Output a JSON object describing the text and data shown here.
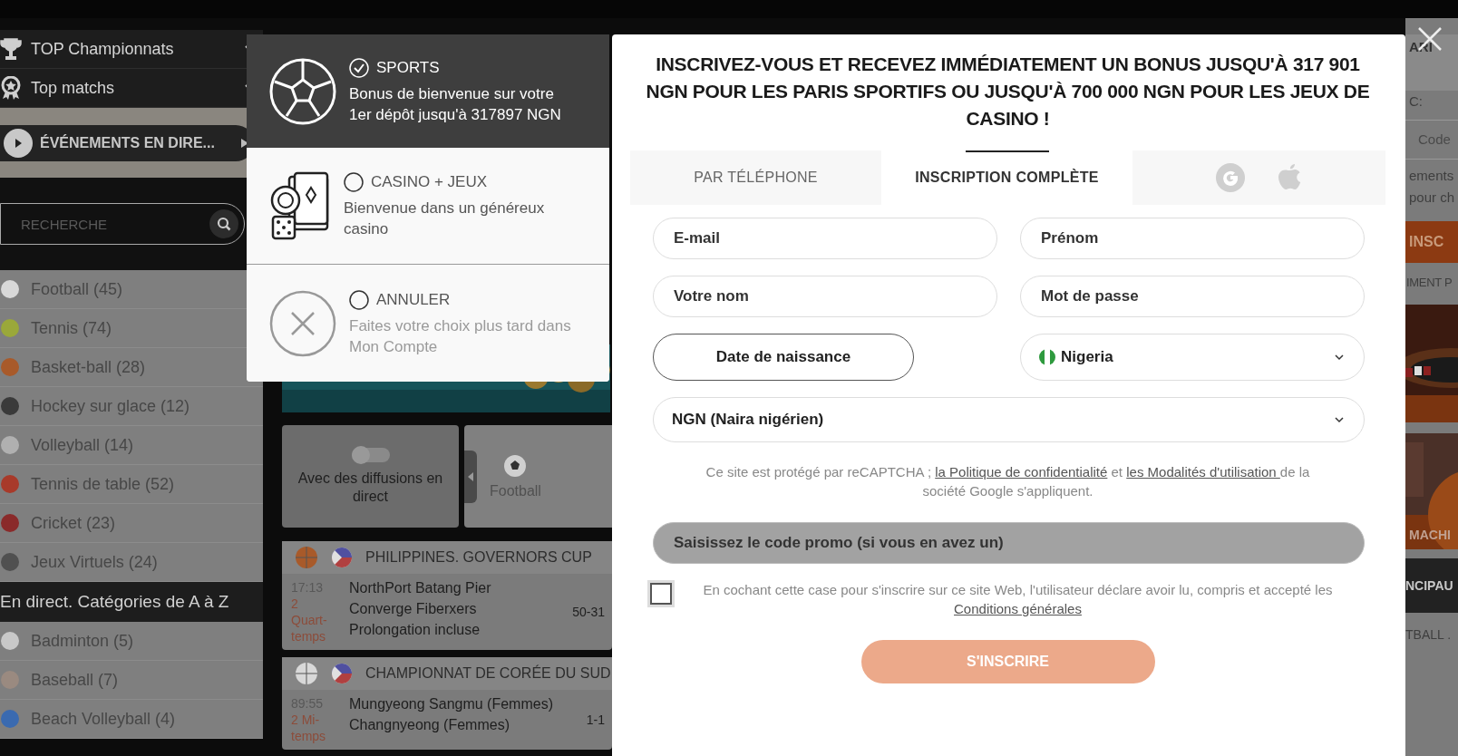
{
  "sidebar": {
    "menu": [
      {
        "label": "TOP Championnats",
        "expanded": false
      },
      {
        "label": "Top matchs",
        "expanded": false
      }
    ],
    "live_button": "ÉVÉNEMENTS EN DIRE...",
    "search": {
      "placeholder": "RECHERCHE"
    },
    "sports": [
      {
        "label": "Football (45)",
        "color": "#d8d8d8"
      },
      {
        "label": "Tennis (74)",
        "color": "#9aa83a"
      },
      {
        "label": "Basket-ball (28)",
        "color": "#a85a2a"
      },
      {
        "label": "Hockey sur glace (12)",
        "color": "#3a3a3a"
      },
      {
        "label": "Volleyball (14)",
        "color": "#b0b0b0"
      },
      {
        "label": "Tennis de table (52)",
        "color": "#a83a2a"
      },
      {
        "label": "Cricket (23)",
        "color": "#8a2a2a"
      },
      {
        "label": "Jeux Virtuels (24)",
        "color": "#505050"
      }
    ],
    "section_title": "En direct. Catégories de A à Z",
    "categories": [
      {
        "label": "Badminton (5)",
        "color": "#c8c8c8"
      },
      {
        "label": "Baseball (7)",
        "color": "#9a8a80"
      },
      {
        "label": "Beach Volleyball (4)",
        "color": "#3a6ab0"
      }
    ]
  },
  "filters": {
    "toggle_label": "Avec des diffusions en direct",
    "toggle_on": false,
    "sport": "Football"
  },
  "events": [
    {
      "league": "PHILIPPINES. GOVERNORS CUP",
      "color": "#a85a2a",
      "time": "17:13",
      "period": "2 Quart-temps",
      "teams": [
        "NorthPort Batang Pier",
        "Converge Fiberxers",
        "Prolongation incluse"
      ],
      "score": "50-31"
    },
    {
      "league": "CHAMPIONNAT DE CORÉE DU SUD",
      "color": "#d8d8d8",
      "time": "89:55",
      "period": "2 Mi-temps",
      "teams": [
        "Mungyeong Sangmu (Femmes)",
        "Changnyeong (Femmes)"
      ],
      "score": "1-1"
    }
  ],
  "bonus_options": [
    {
      "kind": "sports",
      "title": "SPORTS",
      "text": "Bonus de bienvenue sur votre 1er dépôt jusqu'à 317897 NGN",
      "selected": true
    },
    {
      "kind": "casino",
      "title": "CASINO + JEUX",
      "text": "Bienvenue dans un généreux casino",
      "selected": false
    },
    {
      "kind": "cancel",
      "title": "ANNULER",
      "text": "Faites votre choix plus tard dans Mon Compte",
      "selected": false
    }
  ],
  "modal": {
    "title": "INSCRIVEZ-VOUS ET RECEVEZ IMMÉDIATEMENT UN BONUS JUSQU'À 317 901 NGN POUR LES PARIS SPORTIFS OU JUSQU'À 700 000 NGN POUR LES JEUX DE CASINO !",
    "tabs": [
      {
        "label": "PAR TÉLÉPHONE",
        "selected": false
      },
      {
        "label": "INSCRIPTION COMPLÈTE",
        "selected": true
      }
    ],
    "fields": [
      {
        "kind": "input",
        "placeholder": "E-mail"
      },
      {
        "kind": "input",
        "placeholder": "Prénom"
      },
      {
        "kind": "input",
        "placeholder": "Votre nom"
      },
      {
        "kind": "input",
        "placeholder": "Mot de passe"
      },
      {
        "kind": "date",
        "label": "Date de naissance"
      },
      {
        "kind": "country",
        "value": "Nigeria"
      },
      {
        "kind": "currency",
        "value": "NGN (Naira nigérien)"
      }
    ],
    "recaptcha": [
      {
        "kind": "text",
        "text": "Ce site est protégé par reCAPTCHA ; "
      },
      {
        "kind": "link",
        "text": "la Politique de confidentialité"
      },
      {
        "kind": "text",
        "text": " et "
      },
      {
        "kind": "link",
        "text": "les Modalités d'utilisation "
      },
      {
        "kind": "text",
        "text": "de la société Google s'appliquent."
      }
    ],
    "promo": {
      "placeholder": "Saisissez le code promo (si vous en avez un)"
    },
    "terms": {
      "checked": false,
      "parts": [
        {
          "kind": "text",
          "text": "En cochant cette case pour s'inscrire sur ce site Web, l'utilisateur déclare avoir lu, compris et accepté les "
        },
        {
          "kind": "link",
          "text": "Conditions générales"
        }
      ]
    },
    "submit": "S'INSCRIRE"
  },
  "right_strip": {
    "texts": [
      "ARI",
      "C:",
      "Code",
      "ements",
      "pour ch"
    ],
    "banner": "INSC",
    "subtitle": "IMENT P",
    "picture_label": "MACHI",
    "section": "NCIPAU",
    "footer": "TBALL ."
  }
}
